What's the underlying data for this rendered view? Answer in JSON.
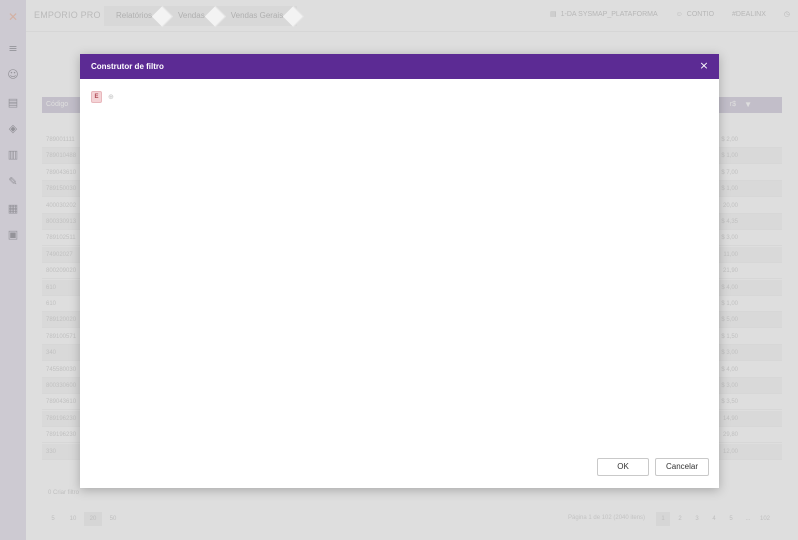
{
  "app": {
    "name": "EMPORIO PRO",
    "breadcrumbs": [
      "Relatórios",
      "Vendas",
      "Vendas Gerais"
    ],
    "top_right": [
      "1-DA SYSMAP_PLATAFORMA",
      "CONTIO",
      "#DEALINX"
    ]
  },
  "grid": {
    "header_first": "Código",
    "header_value": "r$ ▼",
    "rows": [
      {
        "code": "789001111",
        "value": "$ 2,00"
      },
      {
        "code": "789010488",
        "value": "$ 1,00"
      },
      {
        "code": "789043610",
        "value": "$ 7,00"
      },
      {
        "code": "789150030",
        "value": "$ 1,00"
      },
      {
        "code": "400030202",
        "value": "20,00"
      },
      {
        "code": "800330913",
        "value": "$ 4,35"
      },
      {
        "code": "789102511",
        "value": "$ 3,00"
      },
      {
        "code": "74902027",
        "value": "11,00"
      },
      {
        "code": "800209020",
        "value": "21,90"
      },
      {
        "code": "610",
        "value": "$ 4,00"
      },
      {
        "code": "610",
        "value": "$ 1,00"
      },
      {
        "code": "789120020",
        "value": "$ 5,00"
      },
      {
        "code": "789100571",
        "value": "$ 1,50"
      },
      {
        "code": "340",
        "value": "$ 3,00"
      },
      {
        "code": "745580030",
        "value": "$ 4,00"
      },
      {
        "code": "800330600",
        "value": "$ 3,00"
      },
      {
        "code": "789043610",
        "value": "$ 3,50"
      },
      {
        "code": "789196230",
        "value": "14,90"
      },
      {
        "code": "789196230",
        "value": "29,80"
      },
      {
        "code": "330",
        "value": "12,00"
      }
    ],
    "footer_left": "0 Criar filtro",
    "page_sizes": [
      "5",
      "10",
      "20",
      "50"
    ],
    "page_size_selected": "20",
    "pager_info": "Página 1 de 102 (2040 itens)",
    "pages": [
      "1",
      "2",
      "3",
      "4",
      "5",
      "...",
      "102"
    ]
  },
  "modal": {
    "title": "Construtor de filtro",
    "close_icon": "×",
    "group_chip": "E",
    "add_condition": "⊕",
    "ok_label": "OK",
    "cancel_label": "Cancelar",
    "header_color": "#5c2b94"
  }
}
